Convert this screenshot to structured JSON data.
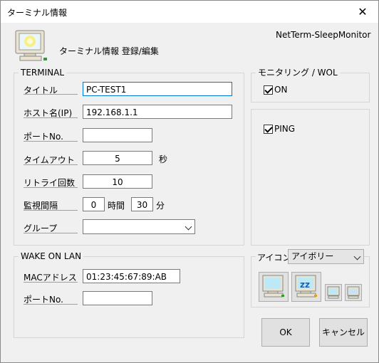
{
  "window": {
    "title": "ターミナル情報",
    "close": "✕"
  },
  "header": {
    "heading": "ターミナル情報 登録/編集",
    "app_name": "NetTerm-SleepMonitor"
  },
  "terminal": {
    "title": "TERMINAL",
    "title_label": "タイトル",
    "title_value": "PC-TEST1",
    "host_label": "ホスト名(IP)",
    "host_value": "192.168.1.1",
    "port_label": "ポートNo.",
    "port_value": "",
    "timeout_label": "タイムアウト",
    "timeout_value": "5",
    "timeout_unit": "秒",
    "retry_label": "リトライ回数",
    "retry_value": "10",
    "interval_label": "監視間隔",
    "interval_hours": "0",
    "hours_unit": "時間",
    "interval_minutes": "30",
    "minutes_unit": "分",
    "group_label": "グループ",
    "group_value": ""
  },
  "wol": {
    "title": "WAKE ON LAN",
    "mac_label": "MACアドレス",
    "mac_value": "01:23:45:67:89:AB",
    "port_label": "ポートNo.",
    "port_value": ""
  },
  "monitoring": {
    "title": "モニタリング / WOL",
    "on_label": "ON",
    "on_checked": true,
    "ping_label": "PING",
    "ping_checked": true
  },
  "icon": {
    "label": "アイコン",
    "selected": "アイボリー",
    "icons": [
      "monitor-large-icon",
      "sleep-monitor-large-icon",
      "monitor-small-icon",
      "sleep-monitor-small-icon"
    ]
  },
  "buttons": {
    "ok": "OK",
    "cancel": "キャンセル"
  },
  "colors": {
    "focus_border": "#0078d7",
    "window_bg": "#f0f0f0",
    "screen_glow": "#f6f08a"
  }
}
